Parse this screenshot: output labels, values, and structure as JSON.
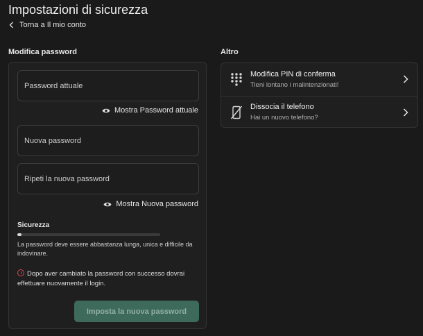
{
  "header": {
    "title": "Impostazioni di sicurezza",
    "back_label": "Torna a Il mio conto"
  },
  "password_section": {
    "heading": "Modifica password",
    "current_placeholder": "Password attuale",
    "show_current_label": "Mostra Password attuale",
    "new_placeholder": "Nuova password",
    "repeat_placeholder": "Ripeti la nuova password",
    "show_new_label": "Mostra Nuova password",
    "strength_label": "Sicurezza",
    "strength_fraction": 0.03,
    "helper_text": "La password deve essere abbastanza lunga, unica e difficile da indovinare.",
    "notice_text": "Dopo aver cambiato la password con successo dovrai effettuare nuovamente il login.",
    "submit_label": "Imposta la nuova password",
    "submit_color": "#3d6a5a",
    "warning_color": "#e0474c"
  },
  "other_section": {
    "heading": "Altro",
    "items": [
      {
        "title": "Modifica PIN di conferma",
        "subtitle": "Tieni lontano i malintenzionati!",
        "icon": "keypad-icon"
      },
      {
        "title": "Dissocia il telefono",
        "subtitle": "Hai un nuovo telefono?",
        "icon": "phone-off-icon"
      }
    ]
  }
}
